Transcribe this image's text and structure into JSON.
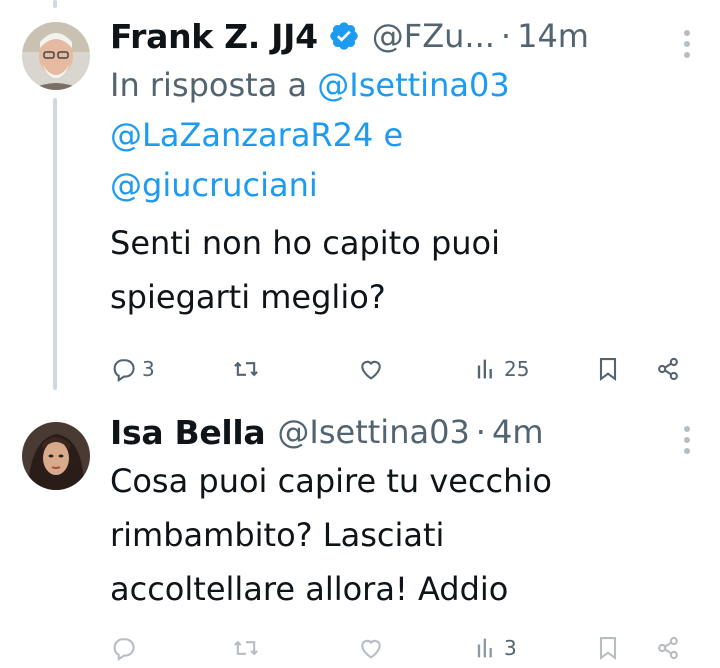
{
  "tweets": [
    {
      "author_name": "Frank Z. JJ4",
      "handle": "@FZu...",
      "dot": "·",
      "time": "14m",
      "reply_prefix": "In risposta a ",
      "reply_mention_1": "@Isettina03",
      "reply_mention_2": "@LaZanzaraR24",
      "reply_and": " e",
      "reply_mention_3": "@giucruciani",
      "text_line_1": "Senti non ho capito puoi",
      "text_line_2": "spiegarti meglio?",
      "replies": "3",
      "views": "25",
      "verified": true
    },
    {
      "author_name": "Isa Bella",
      "handle": "@Isettina03",
      "dot": "·",
      "time": "4m",
      "text_line_1": "Cosa puoi capire tu vecchio",
      "text_line_2": "rimbambito? Lasciati",
      "text_line_3": "accoltellare allora! Addio",
      "views": "3"
    }
  ],
  "colors": {
    "link": "#1d9bf0",
    "muted": "#536471",
    "verified_badge": "#1d9bf0",
    "thread_line": "#cfd9de"
  },
  "icons": [
    "verified-badge-icon",
    "more-dots-icon",
    "reply-icon",
    "retweet-icon",
    "like-icon",
    "views-icon",
    "bookmark-icon",
    "share-icon"
  ]
}
